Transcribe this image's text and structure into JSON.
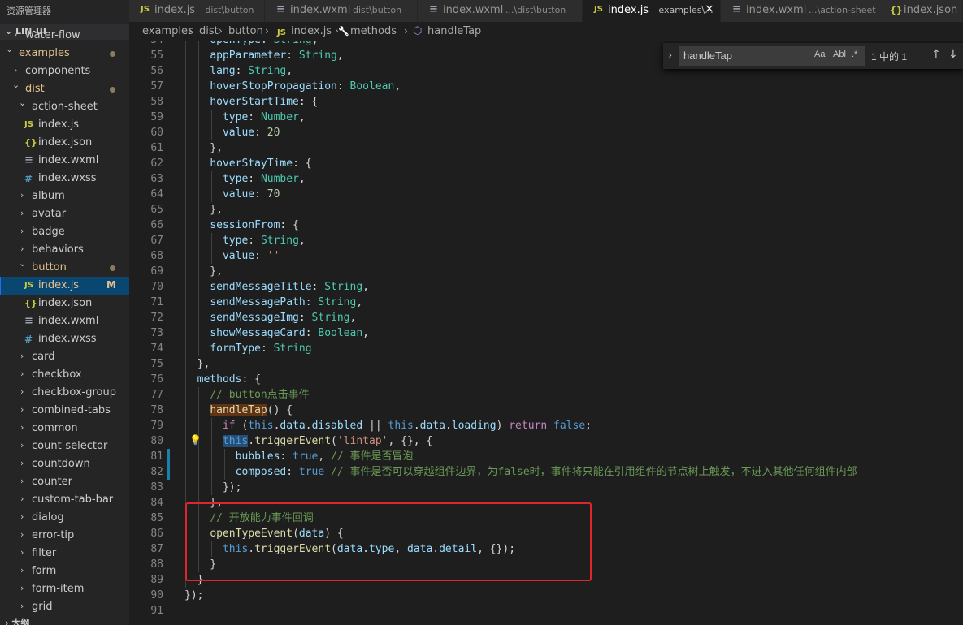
{
  "explorer": {
    "title": "资源管理器",
    "root": "LIN-UI",
    "outline": "大纲"
  },
  "tree": [
    {
      "label": "water-flow",
      "depth": 1,
      "kind": "folder",
      "open": false
    },
    {
      "label": "examples",
      "depth": 0,
      "kind": "folder",
      "open": true,
      "git": true,
      "dot": true
    },
    {
      "label": "components",
      "depth": 1,
      "kind": "folder",
      "open": false
    },
    {
      "label": "dist",
      "depth": 1,
      "kind": "folder",
      "open": true,
      "git": true,
      "dot": true
    },
    {
      "label": "action-sheet",
      "depth": 2,
      "kind": "folder",
      "open": true
    },
    {
      "label": "index.js",
      "depth": 3,
      "kind": "js"
    },
    {
      "label": "index.json",
      "depth": 3,
      "kind": "json"
    },
    {
      "label": "index.wxml",
      "depth": 3,
      "kind": "wxml"
    },
    {
      "label": "index.wxss",
      "depth": 3,
      "kind": "wxss"
    },
    {
      "label": "album",
      "depth": 2,
      "kind": "folder",
      "open": false
    },
    {
      "label": "avatar",
      "depth": 2,
      "kind": "folder",
      "open": false
    },
    {
      "label": "badge",
      "depth": 2,
      "kind": "folder",
      "open": false
    },
    {
      "label": "behaviors",
      "depth": 2,
      "kind": "folder",
      "open": false
    },
    {
      "label": "button",
      "depth": 2,
      "kind": "folder",
      "open": true,
      "git": true,
      "dot": true
    },
    {
      "label": "index.js",
      "depth": 3,
      "kind": "js",
      "selected": true,
      "badge": "M"
    },
    {
      "label": "index.json",
      "depth": 3,
      "kind": "json"
    },
    {
      "label": "index.wxml",
      "depth": 3,
      "kind": "wxml"
    },
    {
      "label": "index.wxss",
      "depth": 3,
      "kind": "wxss"
    },
    {
      "label": "card",
      "depth": 2,
      "kind": "folder",
      "open": false
    },
    {
      "label": "checkbox",
      "depth": 2,
      "kind": "folder",
      "open": false
    },
    {
      "label": "checkbox-group",
      "depth": 2,
      "kind": "folder",
      "open": false
    },
    {
      "label": "combined-tabs",
      "depth": 2,
      "kind": "folder",
      "open": false
    },
    {
      "label": "common",
      "depth": 2,
      "kind": "folder",
      "open": false
    },
    {
      "label": "count-selector",
      "depth": 2,
      "kind": "folder",
      "open": false
    },
    {
      "label": "countdown",
      "depth": 2,
      "kind": "folder",
      "open": false
    },
    {
      "label": "counter",
      "depth": 2,
      "kind": "folder",
      "open": false
    },
    {
      "label": "custom-tab-bar",
      "depth": 2,
      "kind": "folder",
      "open": false
    },
    {
      "label": "dialog",
      "depth": 2,
      "kind": "folder",
      "open": false
    },
    {
      "label": "error-tip",
      "depth": 2,
      "kind": "folder",
      "open": false
    },
    {
      "label": "filter",
      "depth": 2,
      "kind": "folder",
      "open": false
    },
    {
      "label": "form",
      "depth": 2,
      "kind": "folder",
      "open": false
    },
    {
      "label": "form-item",
      "depth": 2,
      "kind": "folder",
      "open": false
    },
    {
      "label": "grid",
      "depth": 2,
      "kind": "folder",
      "open": false
    }
  ],
  "tabs": [
    {
      "icon": "JS",
      "kind": "js",
      "name": "index.js",
      "desc": "dist\\button"
    },
    {
      "icon": "≡",
      "kind": "wxml",
      "name": "index.wxml",
      "desc": "dist\\button"
    },
    {
      "icon": "≡",
      "kind": "wxml",
      "name": "index.wxml",
      "desc": "...\\dist\\button"
    },
    {
      "icon": "JS",
      "kind": "js",
      "name": "index.js",
      "desc": "examples\\...",
      "active": true,
      "close": "×"
    },
    {
      "icon": "≡",
      "kind": "wxml",
      "name": "index.wxml",
      "desc": "...\\action-sheet"
    },
    {
      "icon": "{}",
      "kind": "json",
      "name": "index.json",
      "desc": ""
    }
  ],
  "breadcrumb": {
    "parts": [
      "examples",
      "dist",
      "button",
      "index.js",
      "methods",
      "handleTap"
    ],
    "file_icon": "JS"
  },
  "find": {
    "toggle": "›",
    "query": "handleTap",
    "opt_case": "Aa",
    "opt_word": "Abl",
    "opt_regex": ".*",
    "count": "1 中的 1",
    "up": "↑",
    "down": "↓"
  },
  "code": [
    {
      "n": "54",
      "segs": [
        [
          "p",
          "    "
        ],
        [
          "k",
          "openType"
        ],
        [
          "p",
          ": "
        ],
        [
          "t",
          "String"
        ],
        [
          "p",
          ","
        ]
      ]
    },
    {
      "n": "55",
      "segs": [
        [
          "p",
          "    "
        ],
        [
          "k",
          "appParameter"
        ],
        [
          "p",
          ": "
        ],
        [
          "t",
          "String"
        ],
        [
          "p",
          ","
        ]
      ]
    },
    {
      "n": "56",
      "segs": [
        [
          "p",
          "    "
        ],
        [
          "k",
          "lang"
        ],
        [
          "p",
          ": "
        ],
        [
          "t",
          "String"
        ],
        [
          "p",
          ","
        ]
      ]
    },
    {
      "n": "57",
      "segs": [
        [
          "p",
          "    "
        ],
        [
          "k",
          "hoverStopPropagation"
        ],
        [
          "p",
          ": "
        ],
        [
          "t",
          "Boolean"
        ],
        [
          "p",
          ","
        ]
      ]
    },
    {
      "n": "58",
      "segs": [
        [
          "p",
          "    "
        ],
        [
          "k",
          "hoverStartTime"
        ],
        [
          "p",
          ": {"
        ]
      ]
    },
    {
      "n": "59",
      "segs": [
        [
          "p",
          "      "
        ],
        [
          "k",
          "type"
        ],
        [
          "p",
          ": "
        ],
        [
          "t",
          "Number"
        ],
        [
          "p",
          ","
        ]
      ]
    },
    {
      "n": "60",
      "segs": [
        [
          "p",
          "      "
        ],
        [
          "k",
          "value"
        ],
        [
          "p",
          ": "
        ],
        [
          "n",
          "20"
        ]
      ]
    },
    {
      "n": "61",
      "segs": [
        [
          "p",
          "    },"
        ]
      ]
    },
    {
      "n": "62",
      "segs": [
        [
          "p",
          "    "
        ],
        [
          "k",
          "hoverStayTime"
        ],
        [
          "p",
          ": {"
        ]
      ]
    },
    {
      "n": "63",
      "segs": [
        [
          "p",
          "      "
        ],
        [
          "k",
          "type"
        ],
        [
          "p",
          ": "
        ],
        [
          "t",
          "Number"
        ],
        [
          "p",
          ","
        ]
      ]
    },
    {
      "n": "64",
      "segs": [
        [
          "p",
          "      "
        ],
        [
          "k",
          "value"
        ],
        [
          "p",
          ": "
        ],
        [
          "n",
          "70"
        ]
      ]
    },
    {
      "n": "65",
      "segs": [
        [
          "p",
          "    },"
        ]
      ]
    },
    {
      "n": "66",
      "segs": [
        [
          "p",
          "    "
        ],
        [
          "k",
          "sessionFrom"
        ],
        [
          "p",
          ": {"
        ]
      ]
    },
    {
      "n": "67",
      "segs": [
        [
          "p",
          "      "
        ],
        [
          "k",
          "type"
        ],
        [
          "p",
          ": "
        ],
        [
          "t",
          "String"
        ],
        [
          "p",
          ","
        ]
      ]
    },
    {
      "n": "68",
      "segs": [
        [
          "p",
          "      "
        ],
        [
          "k",
          "value"
        ],
        [
          "p",
          ": "
        ],
        [
          "s",
          "''"
        ]
      ]
    },
    {
      "n": "69",
      "segs": [
        [
          "p",
          "    },"
        ]
      ]
    },
    {
      "n": "70",
      "segs": [
        [
          "p",
          "    "
        ],
        [
          "k",
          "sendMessageTitle"
        ],
        [
          "p",
          ": "
        ],
        [
          "t",
          "String"
        ],
        [
          "p",
          ","
        ]
      ]
    },
    {
      "n": "71",
      "segs": [
        [
          "p",
          "    "
        ],
        [
          "k",
          "sendMessagePath"
        ],
        [
          "p",
          ": "
        ],
        [
          "t",
          "String"
        ],
        [
          "p",
          ","
        ]
      ]
    },
    {
      "n": "72",
      "segs": [
        [
          "p",
          "    "
        ],
        [
          "k",
          "sendMessageImg"
        ],
        [
          "p",
          ": "
        ],
        [
          "t",
          "String"
        ],
        [
          "p",
          ","
        ]
      ]
    },
    {
      "n": "73",
      "segs": [
        [
          "p",
          "    "
        ],
        [
          "k",
          "showMessageCard"
        ],
        [
          "p",
          ": "
        ],
        [
          "t",
          "Boolean"
        ],
        [
          "p",
          ","
        ]
      ]
    },
    {
      "n": "74",
      "segs": [
        [
          "p",
          "    "
        ],
        [
          "k",
          "formType"
        ],
        [
          "p",
          ": "
        ],
        [
          "t",
          "String"
        ]
      ]
    },
    {
      "n": "75",
      "segs": [
        [
          "p",
          "  },"
        ]
      ]
    },
    {
      "n": "76",
      "segs": [
        [
          "p",
          "  "
        ],
        [
          "k",
          "methods"
        ],
        [
          "p",
          ": {"
        ]
      ]
    },
    {
      "n": "77",
      "segs": [
        [
          "p",
          "    "
        ],
        [
          "c",
          "// button点击事件"
        ]
      ]
    },
    {
      "n": "78",
      "segs": [
        [
          "p",
          "    "
        ],
        [
          "fh",
          "handleTap"
        ],
        [
          "p",
          "() {"
        ]
      ]
    },
    {
      "n": "79",
      "segs": [
        [
          "p",
          "      "
        ],
        [
          "kw",
          "if"
        ],
        [
          "p",
          " ("
        ],
        [
          "b",
          "this"
        ],
        [
          "p",
          "."
        ],
        [
          "k",
          "data"
        ],
        [
          "p",
          "."
        ],
        [
          "k",
          "disabled"
        ],
        [
          "p",
          " || "
        ],
        [
          "b",
          "this"
        ],
        [
          "p",
          "."
        ],
        [
          "k",
          "data"
        ],
        [
          "p",
          "."
        ],
        [
          "k",
          "loading"
        ],
        [
          "p",
          ") "
        ],
        [
          "kw",
          "return"
        ],
        [
          "p",
          " "
        ],
        [
          "b",
          "false"
        ],
        [
          "p",
          ";"
        ]
      ]
    },
    {
      "n": "80",
      "segs": [
        [
          "p",
          "      "
        ],
        [
          "bh",
          "this"
        ],
        [
          "p",
          "."
        ],
        [
          "f",
          "triggerEvent"
        ],
        [
          "p",
          "("
        ],
        [
          "s",
          "'lintap'"
        ],
        [
          "p",
          ", {}, {"
        ]
      ]
    },
    {
      "n": "81",
      "segs": [
        [
          "p",
          "        "
        ],
        [
          "k",
          "bubbles"
        ],
        [
          "p",
          ": "
        ],
        [
          "b",
          "true"
        ],
        [
          "p",
          ", "
        ],
        [
          "c",
          "// 事件是否冒泡"
        ]
      ]
    },
    {
      "n": "82",
      "segs": [
        [
          "p",
          "        "
        ],
        [
          "k",
          "composed"
        ],
        [
          "p",
          ": "
        ],
        [
          "b",
          "true"
        ],
        [
          "p",
          " "
        ],
        [
          "c",
          "// 事件是否可以穿越组件边界，为false时，事件将只能在引用组件的节点树上触发，不进入其他任何组件内部"
        ]
      ]
    },
    {
      "n": "83",
      "segs": [
        [
          "p",
          "      });"
        ]
      ]
    },
    {
      "n": "84",
      "segs": [
        [
          "p",
          "    },"
        ]
      ]
    },
    {
      "n": "85",
      "segs": [
        [
          "p",
          "    "
        ],
        [
          "c",
          "// 开放能力事件回调"
        ]
      ]
    },
    {
      "n": "86",
      "segs": [
        [
          "p",
          "    "
        ],
        [
          "f",
          "openTypeEvent"
        ],
        [
          "p",
          "("
        ],
        [
          "k",
          "data"
        ],
        [
          "p",
          ") {"
        ]
      ]
    },
    {
      "n": "87",
      "segs": [
        [
          "p",
          "      "
        ],
        [
          "b",
          "this"
        ],
        [
          "p",
          "."
        ],
        [
          "f",
          "triggerEvent"
        ],
        [
          "p",
          "("
        ],
        [
          "k",
          "data"
        ],
        [
          "p",
          "."
        ],
        [
          "k",
          "type"
        ],
        [
          "p",
          ", "
        ],
        [
          "k",
          "data"
        ],
        [
          "p",
          "."
        ],
        [
          "k",
          "detail"
        ],
        [
          "p",
          ", {});"
        ]
      ]
    },
    {
      "n": "88",
      "segs": [
        [
          "p",
          "    }"
        ]
      ]
    },
    {
      "n": "89",
      "segs": [
        [
          "p",
          "  }"
        ]
      ]
    },
    {
      "n": "90",
      "segs": [
        [
          "p",
          "});"
        ]
      ]
    },
    {
      "n": "91",
      "segs": []
    }
  ],
  "colors": {
    "accent": "#094771",
    "highlight_box": "#e0262a",
    "git_modified": "#e2c08d"
  }
}
